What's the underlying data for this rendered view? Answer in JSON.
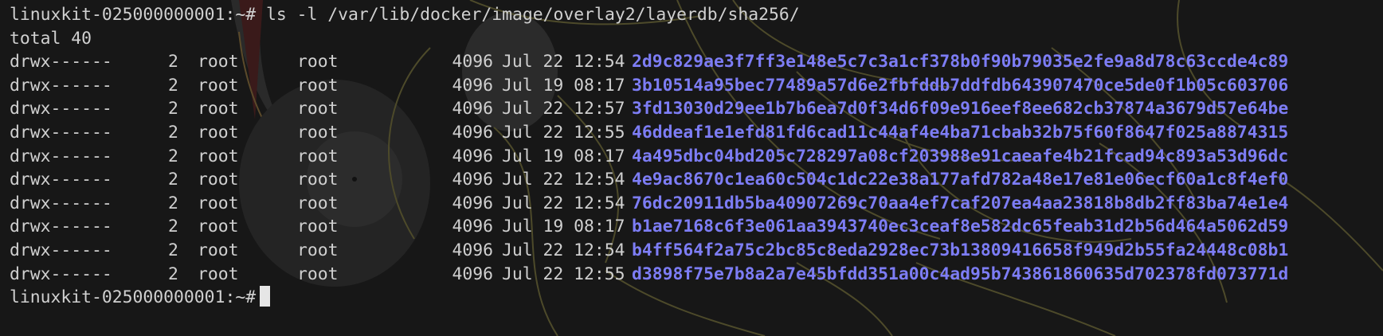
{
  "terminal": {
    "prompt_line": "linuxkit-025000000001:~# ls -l /var/lib/docker/image/overlay2/layerdb/sha256/",
    "total_line": "total 40",
    "final_prompt": "linuxkit-025000000001:~#",
    "entries": [
      {
        "perms": "drwx------",
        "links": "2",
        "owner": "root",
        "group": "root",
        "size": "4096",
        "date": "Jul 22 12:54",
        "name": "2d9c829ae3f7ff3e148e5c7c3a1cf378b0f90b79035e2fe9a8d78c63ccde4c89"
      },
      {
        "perms": "drwx------",
        "links": "2",
        "owner": "root",
        "group": "root",
        "size": "4096",
        "date": "Jul 19 08:17",
        "name": "3b10514a95bec77489a57d6e2fbfddb7ddfdb643907470ce5de0f1b05c603706"
      },
      {
        "perms": "drwx------",
        "links": "2",
        "owner": "root",
        "group": "root",
        "size": "4096",
        "date": "Jul 22 12:57",
        "name": "3fd13030d29ee1b7b6ea7d0f34d6f09e916eef8ee682cb37874a3679d57e64be"
      },
      {
        "perms": "drwx------",
        "links": "2",
        "owner": "root",
        "group": "root",
        "size": "4096",
        "date": "Jul 22 12:55",
        "name": "46ddeaf1e1efd81fd6cad11c44af4e4ba71cbab32b75f60f8647f025a8874315"
      },
      {
        "perms": "drwx------",
        "links": "2",
        "owner": "root",
        "group": "root",
        "size": "4096",
        "date": "Jul 19 08:17",
        "name": "4a495dbc04bd205c728297a08cf203988e91caeafe4b21fcad94c893a53d96dc"
      },
      {
        "perms": "drwx------",
        "links": "2",
        "owner": "root",
        "group": "root",
        "size": "4096",
        "date": "Jul 22 12:54",
        "name": "4e9ac8670c1ea60c504c1dc22e38a177afd782a48e17e81e06ecf60a1c8f4ef0"
      },
      {
        "perms": "drwx------",
        "links": "2",
        "owner": "root",
        "group": "root",
        "size": "4096",
        "date": "Jul 22 12:54",
        "name": "76dc20911db5ba40907269c70aa4ef7caf207ea4aa23818b8db2ff83ba74e1e4"
      },
      {
        "perms": "drwx------",
        "links": "2",
        "owner": "root",
        "group": "root",
        "size": "4096",
        "date": "Jul 19 08:17",
        "name": "b1ae7168c6f3e061aa3943740ec3ceaf8e582dc65feab31d2b56d464a5062d59"
      },
      {
        "perms": "drwx------",
        "links": "2",
        "owner": "root",
        "group": "root",
        "size": "4096",
        "date": "Jul 22 12:54",
        "name": "b4ff564f2a75c2bc85c8eda2928ec73b13809416658f949d2b55fa24448c08b1"
      },
      {
        "perms": "drwx------",
        "links": "2",
        "owner": "root",
        "group": "root",
        "size": "4096",
        "date": "Jul 22 12:55",
        "name": "d3898f75e7b8a2a7e45bfdd351a00c4ad95b743861860635d702378fd073771d"
      }
    ]
  },
  "colors": {
    "background": "#171717",
    "text": "#d0d0d0",
    "directory": "#7d7df5",
    "cursor": "#e6e6e6"
  }
}
